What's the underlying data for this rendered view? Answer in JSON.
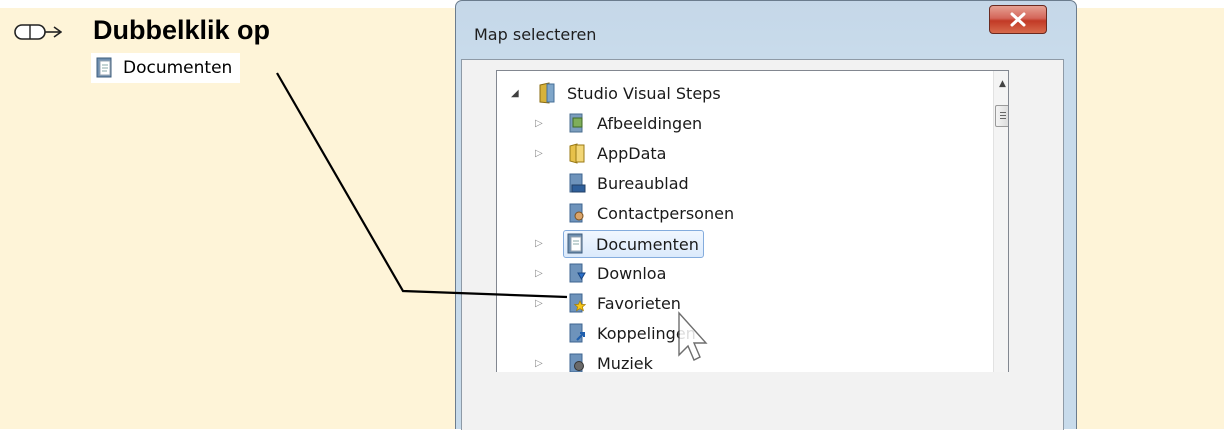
{
  "instruction": {
    "title": "Dubbelklik op",
    "target_label": "Documenten",
    "mouse_icon": "mouse-icon",
    "folder_icon": "documents-folder-icon"
  },
  "dialog": {
    "title": "Map selecteren",
    "close_icon": "close-x-icon"
  },
  "tree": {
    "root": "Studio Visual Steps",
    "items": [
      {
        "label": "Afbeeldingen",
        "expandable": true,
        "icon": "pictures-folder-icon"
      },
      {
        "label": "AppData",
        "expandable": true,
        "icon": "yellow-folder-icon"
      },
      {
        "label": "Bureaublad",
        "expandable": false,
        "icon": "desktop-folder-icon"
      },
      {
        "label": "Contactpersonen",
        "expandable": false,
        "icon": "contacts-folder-icon"
      },
      {
        "label": "Documenten",
        "expandable": true,
        "selected": true,
        "icon": "documents-folder-icon"
      },
      {
        "label": "Downloa",
        "expandable": true,
        "icon": "downloads-folder-icon"
      },
      {
        "label": "Favorieten",
        "expandable": true,
        "icon": "favorites-folder-icon"
      },
      {
        "label": "Koppelingen",
        "expandable": false,
        "icon": "links-folder-icon"
      },
      {
        "label": "Muziek",
        "expandable": true,
        "icon": "music-folder-icon"
      }
    ]
  },
  "colors": {
    "background": "#fef4d8",
    "selection_border": "#84acdd",
    "close_button": "#c23a26"
  }
}
